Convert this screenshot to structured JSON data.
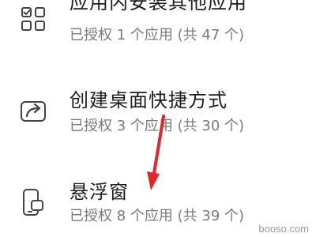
{
  "permissions": {
    "items": [
      {
        "icon": "app-grid-icon",
        "title": "应用内安装其他应用",
        "subtitle": "已授权 1 个应用 (共 47 个)"
      },
      {
        "icon": "share-shortcut-icon",
        "title": "创建桌面快捷方式",
        "subtitle": "已授权 3 个应用 (共 30 个)"
      },
      {
        "icon": "floating-window-icon",
        "title": "悬浮窗",
        "subtitle": "已授权 8 个应用 (共 39 个)"
      }
    ]
  },
  "annotation": {
    "arrow_color": "#e0282c"
  },
  "watermark": "booso.com"
}
